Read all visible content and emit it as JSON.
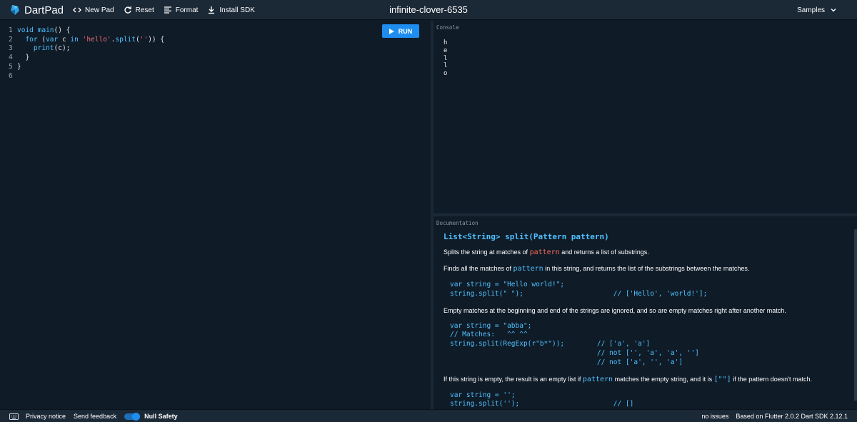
{
  "header": {
    "app_name": "DartPad",
    "buttons": {
      "new_pad": "New Pad",
      "reset": "Reset",
      "format": "Format",
      "install_sdk": "Install SDK"
    },
    "pad_title": "infinite-clover-6535",
    "samples_label": "Samples"
  },
  "editor": {
    "run_label": "RUN",
    "line_numbers": [
      "1",
      "2",
      "3",
      "4",
      "5",
      "6"
    ],
    "lines": {
      "l1_kw": "void",
      "l1_fn": "main",
      "l1_rest": "() {",
      "l2_indent": "  ",
      "l2_kw_for": "for",
      "l2_open": " (",
      "l2_kw_var": "var",
      "l2_mid": " c ",
      "l2_kw_in": "in",
      "l2_space": " ",
      "l2_str1": "'hello'",
      "l2_dot": ".",
      "l2_fn": "split",
      "l2_paren": "(",
      "l2_str2": "''",
      "l2_close": ")) {",
      "l3_indent": "    ",
      "l3_fn": "print",
      "l3_rest": "(c);",
      "l4": "  }",
      "l5": "}",
      "l6": ""
    }
  },
  "console": {
    "label": "Console",
    "output": [
      "h",
      "e",
      "l",
      "l",
      "o"
    ]
  },
  "docs": {
    "label": "Documentation",
    "signature": "List<String> split(Pattern pattern)",
    "p1_a": "Splits the string at matches of ",
    "p1_code": "pattern",
    "p1_b": " and returns a list of substrings.",
    "p2_a": "Finds all the matches of ",
    "p2_code": "pattern",
    "p2_b": " in this string, and returns the list of the substrings between the matches.",
    "code1": "var string = \"Hello world!\";\nstring.split(\" \");                      // ['Hello', 'world!'];",
    "p3": "Empty matches at the beginning and end of the strings are ignored, and so are empty matches right after another match.",
    "code2": "var string = \"abba\";\n// Matches:   ^^ ^^\nstring.split(RegExp(r\"b*\"));        // ['a', 'a']\n                                    // not ['', 'a', 'a', '']\n                                    // not ['a', '', 'a']",
    "p4_a": "If this string is empty, the result is an empty list if ",
    "p4_code1": "pattern",
    "p4_b": " matches the empty string, and it is ",
    "p4_code2": "[\"\"]",
    "p4_c": " if the pattern doesn't match.",
    "code3": "var string = '';\nstring.split('');                       // []"
  },
  "footer": {
    "privacy": "Privacy notice",
    "feedback": "Send feedback",
    "null_safety": "Null Safety",
    "null_safety_on": true,
    "issues": "no issues",
    "version": "Based on Flutter 2.0.2 Dart SDK 2.12.1"
  },
  "colors": {
    "background": "#0f1b27",
    "chrome": "#1b2836",
    "accent": "#1e8df0",
    "keyword": "#4fc1ff",
    "string": "#f06b74"
  }
}
